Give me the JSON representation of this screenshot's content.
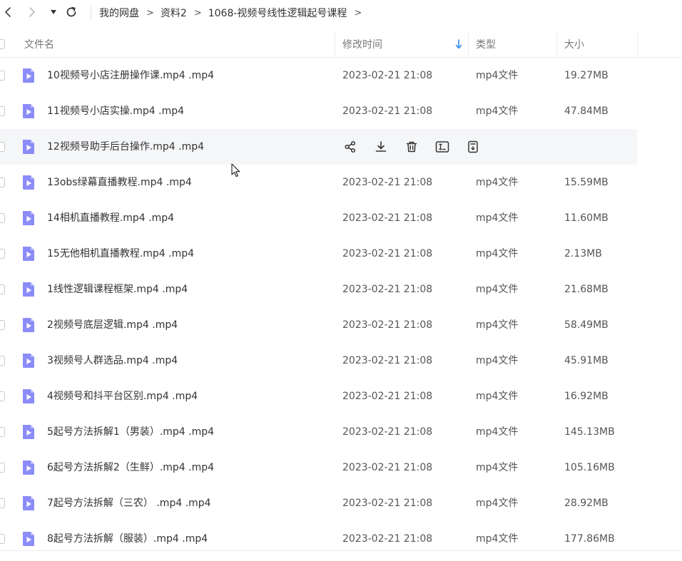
{
  "breadcrumb": [
    {
      "label": "我的网盘"
    },
    {
      "label": "资料2"
    },
    {
      "label": "1068-视频号线性逻辑起号课程"
    }
  ],
  "breadcrumb_sep": ">",
  "columns": {
    "name": "文件名",
    "modified": "修改时间",
    "type": "类型",
    "size": "大小"
  },
  "sort_column": "modified",
  "colors": {
    "accent": "#2f8cf0",
    "file_icon": "#8b8cf7",
    "row_hover": "#f5f6f8"
  },
  "rows": [
    {
      "name": "10视频号小店注册操作课.mp4 .mp4",
      "date": "2023-02-21 21:08",
      "type": "mp4文件",
      "size": "19.27MB"
    },
    {
      "name": "11视频号小店实操.mp4 .mp4",
      "date": "2023-02-21 21:08",
      "type": "mp4文件",
      "size": "47.84MB"
    },
    {
      "name": "12视频号助手后台操作.mp4 .mp4",
      "date": "",
      "type": "",
      "size": "",
      "hovered": true
    },
    {
      "name": "13obs绿幕直播教程.mp4 .mp4",
      "date": "2023-02-21 21:08",
      "type": "mp4文件",
      "size": "15.59MB"
    },
    {
      "name": "14相机直播教程.mp4 .mp4",
      "date": "2023-02-21 21:08",
      "type": "mp4文件",
      "size": "11.60MB"
    },
    {
      "name": "15无他相机直播教程.mp4 .mp4",
      "date": "2023-02-21 21:08",
      "type": "mp4文件",
      "size": "2.13MB"
    },
    {
      "name": "1线性逻辑课程框架.mp4 .mp4",
      "date": "2023-02-21 21:08",
      "type": "mp4文件",
      "size": "21.68MB"
    },
    {
      "name": "2视频号底层逻辑.mp4 .mp4",
      "date": "2023-02-21 21:08",
      "type": "mp4文件",
      "size": "58.49MB"
    },
    {
      "name": "3视频号人群选品.mp4 .mp4",
      "date": "2023-02-21 21:08",
      "type": "mp4文件",
      "size": "45.91MB"
    },
    {
      "name": "4视频号和抖平台区别.mp4 .mp4",
      "date": "2023-02-21 21:08",
      "type": "mp4文件",
      "size": "16.92MB"
    },
    {
      "name": "5起号方法拆解1（男装）.mp4 .mp4",
      "date": "2023-02-21 21:08",
      "type": "mp4文件",
      "size": "145.13MB"
    },
    {
      "name": "6起号方法拆解2（生鲜）.mp4 .mp4",
      "date": "2023-02-21 21:08",
      "type": "mp4文件",
      "size": "105.16MB"
    },
    {
      "name": "7起号方法拆解（三农） .mp4 .mp4",
      "date": "2023-02-21 21:08",
      "type": "mp4文件",
      "size": "28.92MB"
    },
    {
      "name": "8起号方法拆解（服装）.mp4 .mp4",
      "date": "2023-02-21 21:08",
      "type": "mp4文件",
      "size": "177.86MB"
    }
  ],
  "row_actions": [
    {
      "icon": "share-icon"
    },
    {
      "icon": "download-icon"
    },
    {
      "icon": "delete-icon"
    },
    {
      "icon": "rename-icon"
    },
    {
      "icon": "more-icon"
    }
  ]
}
